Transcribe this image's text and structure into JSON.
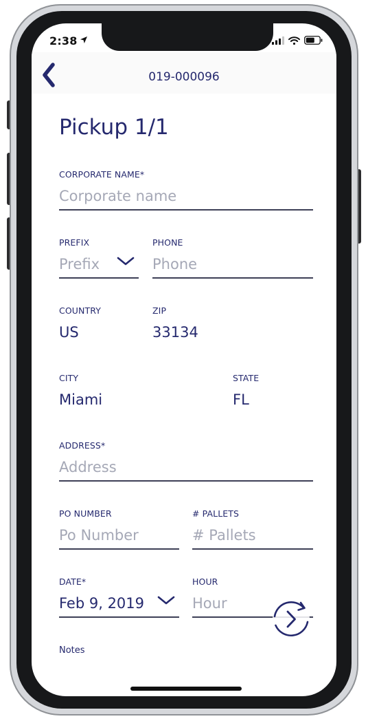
{
  "status_bar": {
    "time": "2:38"
  },
  "header": {
    "title": "019-000096"
  },
  "form": {
    "title": "Pickup 1/1",
    "corporate_name": {
      "label": "CORPORATE NAME*",
      "placeholder": "Corporate name"
    },
    "prefix": {
      "label": "PREFIX",
      "placeholder": "Prefix"
    },
    "phone": {
      "label": "PHONE",
      "placeholder": "Phone"
    },
    "country": {
      "label": "COUNTRY",
      "value": "US"
    },
    "zip": {
      "label": "ZIP",
      "value": "33134"
    },
    "city": {
      "label": "CITY",
      "value": "Miami"
    },
    "state": {
      "label": "STATE",
      "value": "FL"
    },
    "address": {
      "label": "ADDRESS*",
      "placeholder": "Address"
    },
    "po_number": {
      "label": "PO NUMBER",
      "placeholder": "Po Number"
    },
    "pallets": {
      "label": "# PALLETS",
      "placeholder": "# Pallets"
    },
    "date": {
      "label": "DATE*",
      "value": "Feb 9, 2019"
    },
    "hour": {
      "label": "HOUR",
      "placeholder": "Hour"
    },
    "notes": {
      "label": "Notes"
    }
  },
  "colors": {
    "accent": "#25296e",
    "placeholder": "#a5a8b6",
    "underline": "#3d3f56"
  }
}
